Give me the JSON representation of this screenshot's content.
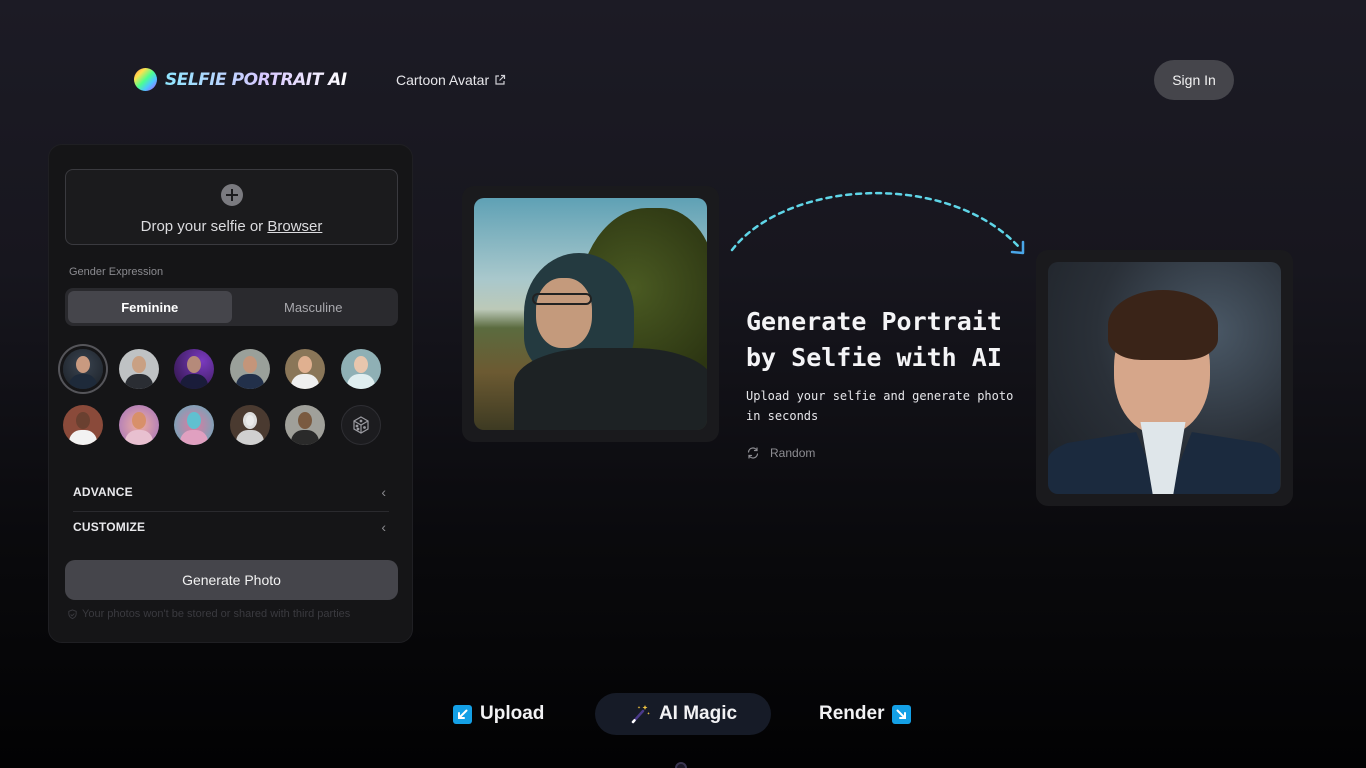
{
  "header": {
    "logo_text": "SELFIE PORTRAIT AI",
    "nav_link": "Cartoon Avatar",
    "nav_link_icon": "external-link-icon",
    "sign_in": "Sign In"
  },
  "panel": {
    "dropzone": {
      "icon": "plus-circle-icon",
      "text": "Drop your selfie or",
      "browse_link": "Browser"
    },
    "gender_label": "Gender Expression",
    "gender_options": [
      {
        "label": "Feminine",
        "selected": true
      },
      {
        "label": "Masculine",
        "selected": false
      }
    ],
    "styles": [
      {
        "name": "studio-portrait-suit",
        "selected": true
      },
      {
        "name": "business-suit-grey",
        "selected": false
      },
      {
        "name": "purple-light-suit",
        "selected": false
      },
      {
        "name": "press-conference",
        "selected": false
      },
      {
        "name": "doctor-coat",
        "selected": false
      },
      {
        "name": "clinic-portrait",
        "selected": false
      },
      {
        "name": "athlete",
        "selected": false
      },
      {
        "name": "pastel-dream",
        "selected": false
      },
      {
        "name": "holi-festival",
        "selected": false
      },
      {
        "name": "astronaut",
        "selected": false
      },
      {
        "name": "street-friends",
        "selected": false
      },
      {
        "name": "random-dice",
        "selected": false,
        "icon": "dice-icon"
      }
    ],
    "accordions": [
      {
        "label": "ADVANCE",
        "icon": "chevron-left-icon"
      },
      {
        "label": "CUSTOMIZE",
        "icon": "chevron-left-icon"
      }
    ],
    "generate_button": "Generate Photo",
    "privacy_note": "Your photos won't be stored or shared with third parties",
    "privacy_icon": "shield-check-icon"
  },
  "hero": {
    "title_line1": "Generate Portrait",
    "title_line2": "by Selfie with AI",
    "subtitle": "Upload your selfie and generate photo in seconds",
    "random_label": "Random",
    "random_icon": "refresh-icon",
    "input_image": "selfie-photo",
    "output_image": "generated-portrait"
  },
  "steps": [
    {
      "label": "Upload",
      "icon": "arrow-down-left-icon"
    },
    {
      "label": "AI Magic",
      "icon": "magic-wand-icon",
      "active": true
    },
    {
      "label": "Render",
      "icon": "arrow-down-right-icon"
    }
  ],
  "colors": {
    "accent_blue": "#14a0e6",
    "arc_cyan": "#5fd6e8",
    "button_grey": "#45454b",
    "panel_bg": "#151517"
  }
}
